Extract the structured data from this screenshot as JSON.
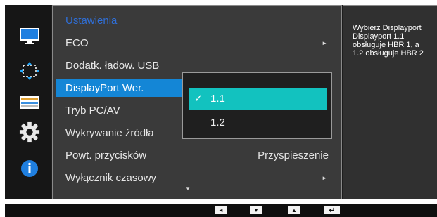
{
  "menu": {
    "title": "Ustawienia",
    "items": [
      {
        "label": "ECO",
        "has_arrow": true,
        "arrow": "►"
      },
      {
        "label": "Dodatk. ładow. USB"
      },
      {
        "label": "DisplayPort Wer.",
        "selected": true
      },
      {
        "label": "Tryb PC/AV"
      },
      {
        "label": "Wykrywanie źródła"
      },
      {
        "label": "Powt. przycisków",
        "value": "Przyspieszenie"
      },
      {
        "label": "Wyłącznik czasowy",
        "has_arrow": true,
        "arrow": "►"
      }
    ],
    "more_indicator": "▼"
  },
  "submenu": {
    "options": [
      {
        "label": "1.1",
        "check": "✓",
        "active": true
      },
      {
        "label": "1.2"
      }
    ]
  },
  "help": {
    "text": "Wybierz Displayport\nDisplayport 1.1\nobsługuje HBR 1, a\n1.2 obsługuje HBR 2"
  },
  "sidebar": {
    "icons": [
      "monitor-icon",
      "size-position-icon",
      "color-icon",
      "settings-gear-icon",
      "information-icon"
    ]
  },
  "bottom_bar": {
    "buttons": [
      {
        "symbol": "◄",
        "name": "left-button"
      },
      {
        "symbol": "▼",
        "name": "down-button"
      },
      {
        "symbol": "▲",
        "name": "up-button"
      },
      {
        "symbol": "↵",
        "name": "enter-button"
      }
    ]
  },
  "colors": {
    "title": "#2f6fd8",
    "selection": "#1486d6",
    "active_option": "#12c2bf"
  }
}
